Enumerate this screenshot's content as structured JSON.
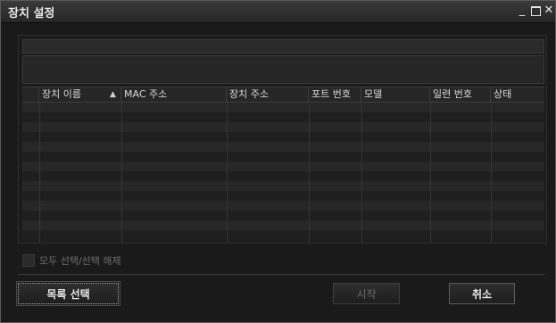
{
  "window": {
    "title": "장치 설정",
    "controls": {
      "minimize": "_",
      "close": "✕"
    }
  },
  "table": {
    "sort_indicator": "▲",
    "columns": [
      "장치 이름",
      "MAC 주소",
      "장치 주소",
      "포트 번호",
      "모델",
      "일련 번호",
      "상태"
    ],
    "rows": []
  },
  "select_all": {
    "label": "모두 선택/선택 해제",
    "checked": false,
    "enabled": false
  },
  "buttons": {
    "list_select": "목록 선택",
    "start": "시작",
    "cancel": "취소"
  }
}
